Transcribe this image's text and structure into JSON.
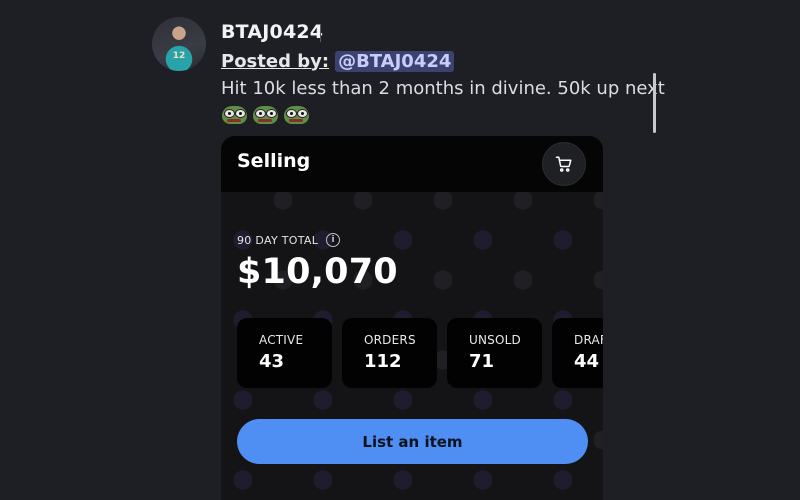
{
  "post": {
    "author": "BTAJ0424",
    "posted_by_label": "Posted by:",
    "mention": "@BTAJ0424",
    "message": "Hit 10k less than 2 months in divine. 50k up next",
    "avatar_jersey_number": "12",
    "emojis": [
      "frog-emoji",
      "frog-emoji",
      "frog-emoji"
    ]
  },
  "selling": {
    "title": "Selling",
    "cart_icon": "cart-icon",
    "total_label": "90 DAY TOTAL",
    "info_icon_glyph": "i",
    "total_value": "$10,070",
    "stats": [
      {
        "label": "ACTIVE",
        "value": "43"
      },
      {
        "label": "ORDERS",
        "value": "112"
      },
      {
        "label": "UNSOLD",
        "value": "71"
      },
      {
        "label": "DRAFTS",
        "value": "44"
      }
    ],
    "list_button": "List an item"
  },
  "colors": {
    "background": "#1e1f24",
    "accent": "#4f8ef2",
    "mention_bg": "#3c4270",
    "mention_text": "#c9cdfb"
  }
}
